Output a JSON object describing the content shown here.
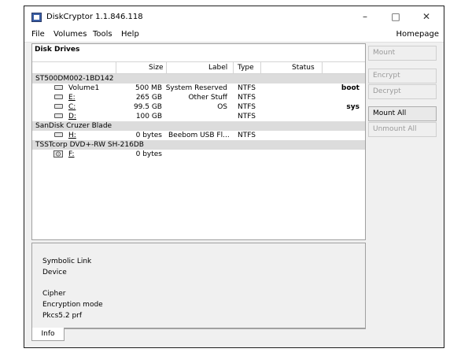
{
  "window": {
    "title": "DiskCryptor 1.1.846.118"
  },
  "menu": {
    "file": "File",
    "volumes": "Volumes",
    "tools": "Tools",
    "help": "Help",
    "homepage": "Homepage"
  },
  "drives_pane": {
    "title": "Disk Drives",
    "columns": {
      "size": "Size",
      "label": "Label",
      "type": "Type",
      "status": "Status"
    },
    "disks": [
      {
        "name": "ST500DM002-1BD142",
        "volumes": [
          {
            "name": "Volume1",
            "size": "500 MB",
            "label": "System Reserved",
            "type": "NTFS",
            "status": "boot"
          },
          {
            "name": "E:",
            "size": "265 GB",
            "label": "Other Stuff",
            "type": "NTFS",
            "status": ""
          },
          {
            "name": "C:",
            "size": "99.5 GB",
            "label": "OS",
            "type": "NTFS",
            "status": "sys"
          },
          {
            "name": "D:",
            "size": "100 GB",
            "label": "",
            "type": "NTFS",
            "status": ""
          }
        ]
      },
      {
        "name": "SanDisk Cruzer Blade",
        "volumes": [
          {
            "name": "H:",
            "size": "0 bytes",
            "label": "Beebom USB Fl...",
            "type": "NTFS",
            "status": ""
          }
        ]
      },
      {
        "name": "TSSTcorp DVD+-RW SH-216DB",
        "volumes": [
          {
            "name": "F:",
            "size": "0 bytes",
            "label": "",
            "type": "",
            "status": ""
          }
        ]
      }
    ]
  },
  "info_pane": {
    "lines": [
      "Symbolic Link",
      "Device",
      "Cipher",
      "Encryption mode",
      "Pkcs5.2 prf"
    ],
    "tab": "Info"
  },
  "buttons": {
    "mount": "Mount",
    "encrypt": "Encrypt",
    "decrypt": "Decrypt",
    "mount_all": "Mount All",
    "unmount_all": "Unmount All"
  }
}
